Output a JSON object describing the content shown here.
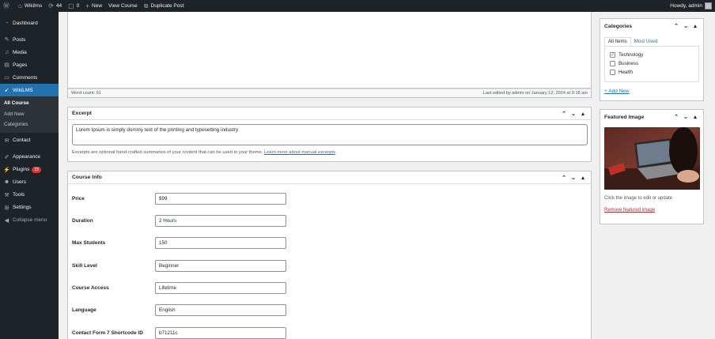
{
  "admin_bar": {
    "site_name": "Wikilms",
    "updates_count": "44",
    "comments_count": "0",
    "new_label": "New",
    "view_course_label": "View Course",
    "duplicate_label": "Duplicate Post",
    "greeting": "Howdy, admin"
  },
  "sidebar": {
    "items": [
      {
        "label": "Dashboard",
        "icon": "dashboard-icon"
      },
      {
        "label": "Posts",
        "icon": "pin-icon"
      },
      {
        "label": "Media",
        "icon": "media-icon"
      },
      {
        "label": "Pages",
        "icon": "page-icon"
      },
      {
        "label": "Comments",
        "icon": "comment-icon"
      },
      {
        "label": "WikiLMS",
        "icon": "plugin-icon"
      },
      {
        "label": "Contact",
        "icon": "mail-icon"
      },
      {
        "label": "Appearance",
        "icon": "brush-icon"
      },
      {
        "label": "Plugins",
        "icon": "plug-icon",
        "badge": "23"
      },
      {
        "label": "Users",
        "icon": "user-icon"
      },
      {
        "label": "Tools",
        "icon": "wrench-icon"
      },
      {
        "label": "Settings",
        "icon": "settings-icon"
      },
      {
        "label": "Collapse menu",
        "icon": "collapse-icon"
      }
    ],
    "submenu": [
      "All Course",
      "Add New",
      "Categories"
    ]
  },
  "editor": {
    "word_count": "Word count: 91",
    "last_edited": "Last edited by admin on January 12, 2024 at 9:18 am"
  },
  "excerpt": {
    "title": "Excerpt",
    "text": "Lorem Ipsum is simply dummy text of the printing and typesetting industry",
    "help_text": "Excerpts are optional hand-crafted summaries of your content that can be used in your theme.",
    "help_link": "Learn more about manual excerpts",
    "help_suffix": "."
  },
  "course_info": {
    "title": "Course Info",
    "fields": [
      {
        "label": "Price",
        "value": "$99"
      },
      {
        "label": "Duration",
        "value": "2 Hours"
      },
      {
        "label": "Max Students",
        "value": "150"
      },
      {
        "label": "Skill Level",
        "value": "Beginner"
      },
      {
        "label": "Course Access",
        "value": "Lifetime"
      },
      {
        "label": "Language",
        "value": "English"
      },
      {
        "label": "Contact Form 7 Shortcode ID",
        "value": "b71211c"
      }
    ]
  },
  "categories": {
    "title": "Categories",
    "tab_all": "All Items",
    "tab_most_used": "Most Used",
    "items": [
      {
        "label": "Technology",
        "checked": true
      },
      {
        "label": "Business",
        "checked": false
      },
      {
        "label": "Health",
        "checked": false
      }
    ],
    "add_new": "+ Add New"
  },
  "featured_image": {
    "title": "Featured Image",
    "caption": "Click the image to edit or update",
    "remove": "Remove featured image"
  },
  "colors": {
    "admin_dark": "#1d2327",
    "accent": "#2271b1",
    "danger": "#d63638"
  }
}
